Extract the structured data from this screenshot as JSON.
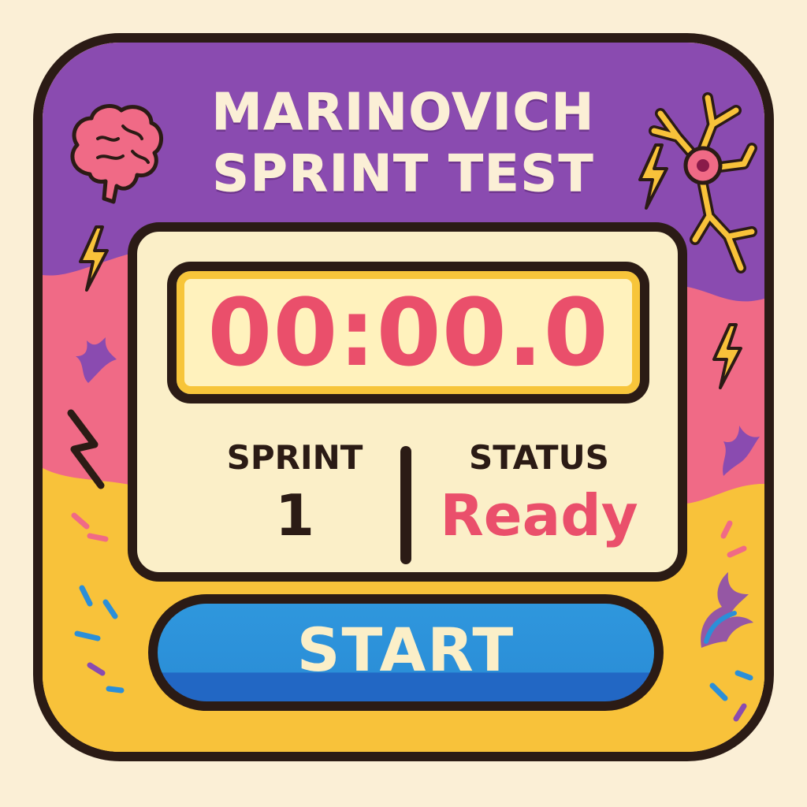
{
  "title": {
    "line1": "MARINOVICH",
    "line2": "SPRINT TEST"
  },
  "timer": {
    "display": "00:00.0"
  },
  "stats": {
    "sprint_label": "SPRINT",
    "sprint_value": "1",
    "status_label": "STATUS",
    "status_value": "Ready"
  },
  "controls": {
    "start_label": "START"
  },
  "icons": {
    "brain": "brain-icon",
    "neuron": "neuron-icon",
    "lightning": "lightning-bolt-icon",
    "splash": "splash-icon"
  },
  "colors": {
    "outline": "#2b1b15",
    "purple": "#8a4bb0",
    "pink": "#f06a86",
    "yellow": "#f8c23a",
    "cream": "#fbefc8",
    "timer_red": "#ea4f6b",
    "button_blue": "#2b8fd8"
  }
}
